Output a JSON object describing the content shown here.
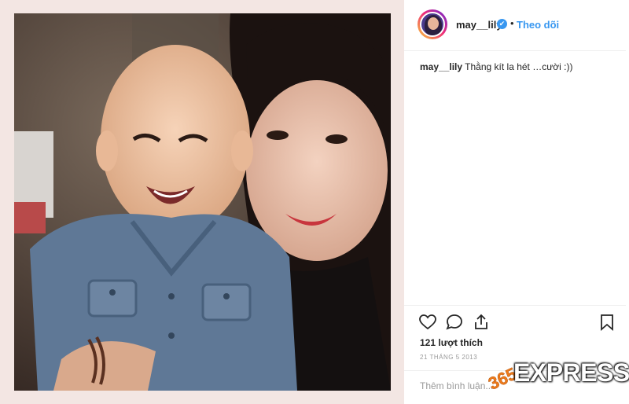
{
  "post": {
    "username": "may__lily",
    "verified_mark": "✔",
    "separator": "•",
    "follow_label": "Theo dõi",
    "caption_user": "may__lily",
    "caption_text": " Thằng kít la hét …cười :))",
    "likes": "121 lượt thích",
    "date": "21 THÁNG 5 2013",
    "comment_placeholder": "Thêm bình luận..."
  },
  "icons": {
    "like": "heart-icon",
    "comment": "comment-icon",
    "share": "share-icon",
    "save": "bookmark-icon"
  },
  "watermark": {
    "logo_digits": "365",
    "brand": "EXPRESS",
    "accent": "#ee7a1b"
  },
  "colors": {
    "link": "#3897f0",
    "text": "#262626",
    "muted": "#999999",
    "frame": "#f3e6e3"
  }
}
